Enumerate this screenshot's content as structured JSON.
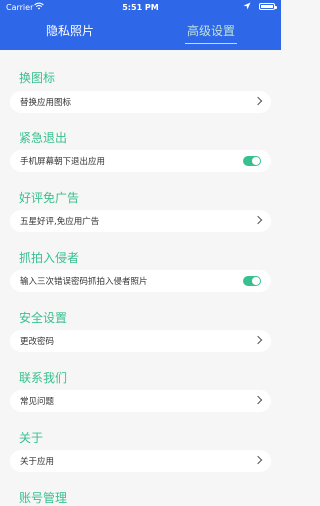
{
  "status": {
    "carrier": "Carrier",
    "time": "5:51 PM"
  },
  "tabs": [
    {
      "label": "隐私照片",
      "active": false
    },
    {
      "label": "高级设置",
      "active": true
    }
  ],
  "sections": [
    {
      "title": "换图标",
      "item": {
        "label": "替换应用图标",
        "control": "chevron"
      }
    },
    {
      "title": "紧急退出",
      "item": {
        "label": "手机屏幕朝下退出应用",
        "control": "toggle",
        "on": true
      }
    },
    {
      "title": "好评免广告",
      "item": {
        "label": "五星好评,免应用广告",
        "control": "chevron"
      }
    },
    {
      "title": "抓拍入侵者",
      "item": {
        "label": "输入三次错误密码抓拍入侵者照片",
        "control": "toggle",
        "on": true
      }
    },
    {
      "title": "安全设置",
      "item": {
        "label": "更改密码",
        "control": "chevron"
      }
    },
    {
      "title": "联系我们",
      "item": {
        "label": "常见问题",
        "control": "chevron"
      }
    },
    {
      "title": "关于",
      "item": {
        "label": "关于应用",
        "control": "chevron"
      }
    },
    {
      "title": "账号管理",
      "item": null
    }
  ],
  "colors": {
    "header": "#2e67e8",
    "accent": "#38c08f",
    "background": "#f6f6f6"
  }
}
